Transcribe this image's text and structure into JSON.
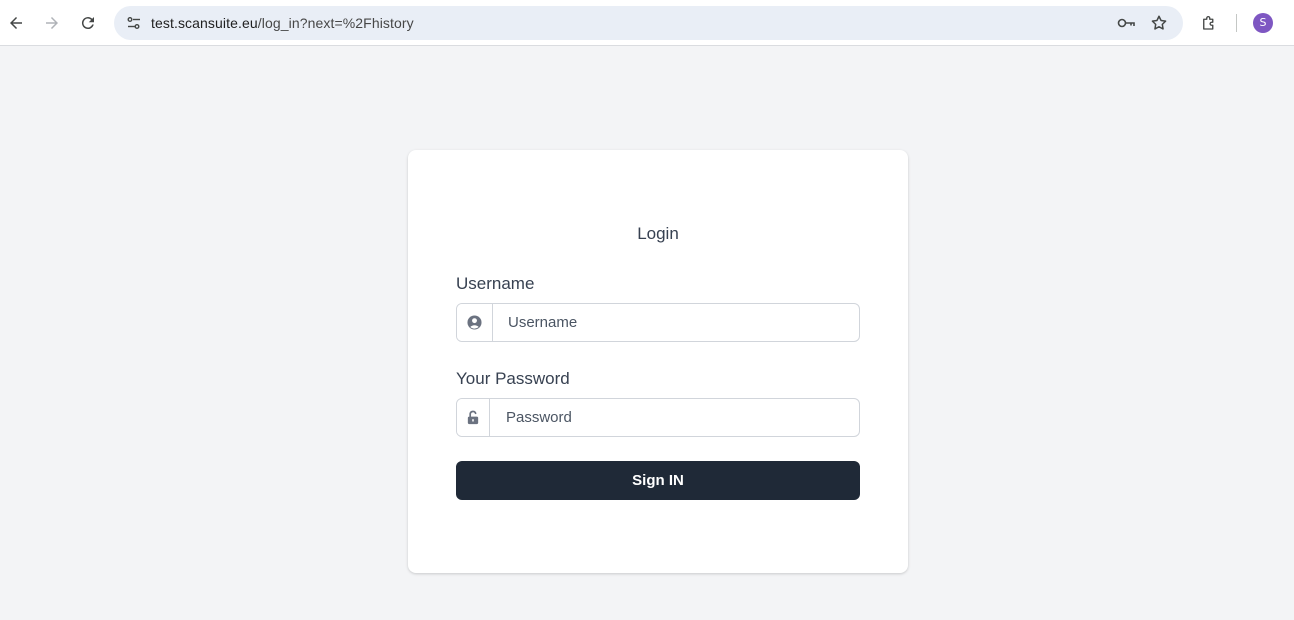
{
  "browser": {
    "url_host": "test.scansuite.eu",
    "url_path": "/log_in?next=%2Fhistory",
    "profile_initial": "S",
    "icons": [
      "back-icon",
      "forward-icon",
      "reload-icon",
      "site-info-icon",
      "password-key-icon",
      "bookmark-star-icon",
      "extensions-icon"
    ]
  },
  "login": {
    "title": "Login",
    "username_label": "Username",
    "username_placeholder": "Username",
    "username_value": "",
    "password_label": "Your Password",
    "password_placeholder": "Password",
    "password_value": "",
    "submit_label": "Sign IN"
  },
  "colors": {
    "page_bg": "#f3f4f6",
    "button_bg": "#1f2937",
    "avatar_bg": "#7e57c2"
  }
}
